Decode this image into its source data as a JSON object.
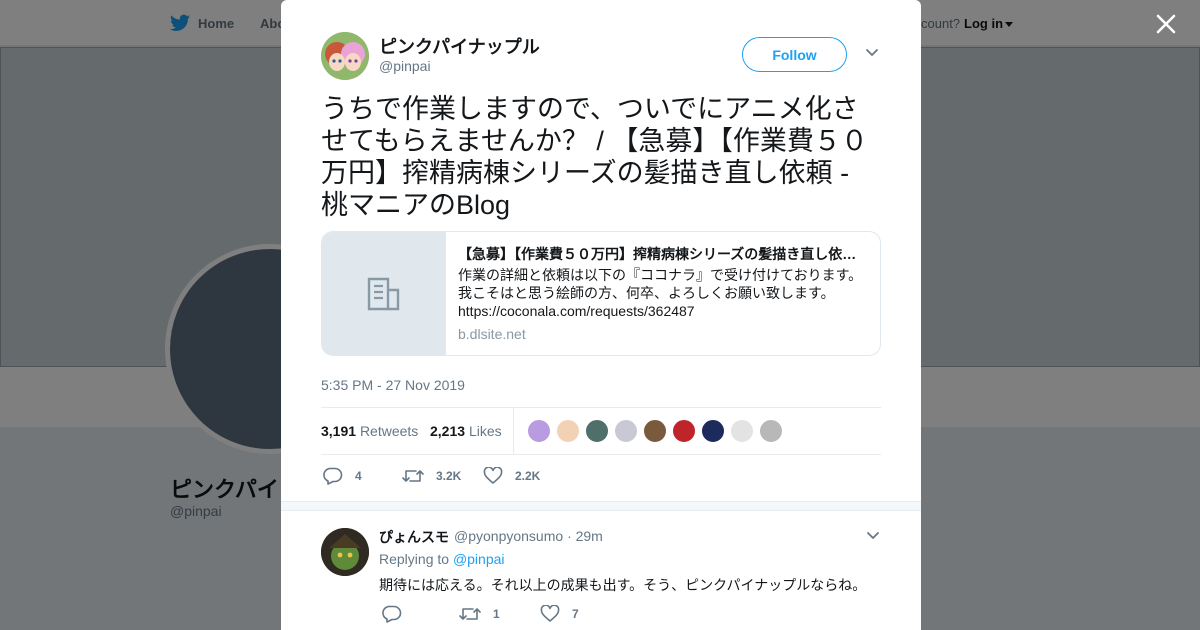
{
  "background": {
    "nav": {
      "home_label": "Home",
      "about_label": "Abo"
    },
    "login": {
      "prompt": "count?",
      "login_label": "Log in"
    },
    "profile_name": "ピンクパイ",
    "profile_handle": "@pinpai"
  },
  "tweet": {
    "author_name": "ピンクパイナップル",
    "author_handle": "@pinpai",
    "follow_label": "Follow",
    "text": "うちで作業しますので、ついでにアニメ化させてもらえませんか？ / 【急募】【作業費５０万円】搾精病棟シリーズの髪描き直し依頼 - 桃マニアのBlog",
    "card": {
      "title": "【急募】【作業費５０万円】搾精病棟シリーズの髪描き直し依…",
      "description_lines": [
        "作業の詳細と依頼は以下の『ココナラ』で受け付けております。",
        "我こそはと思う絵師の方、何卒、よろしくお願い致します。",
        "https://coconala.com/requests/362487"
      ],
      "domain": "b.dlsite.net"
    },
    "timestamp": "5:35 PM - 27 Nov 2019",
    "retweets_count": "3,191",
    "retweets_label": "Retweets",
    "likes_count": "2,213",
    "likes_label": "Likes",
    "liker_colors": [
      "#b99be0",
      "#f3d1b5",
      "#4f6f6a",
      "#c9c9d6",
      "#7a5a3c",
      "#c0242b",
      "#1d2a5c",
      "#e3e3e3",
      "#b8b8b8"
    ],
    "actions": {
      "replies": "4",
      "retweets": "3.2K",
      "likes": "2.2K"
    }
  },
  "reply": {
    "name": "ぴょんスモ",
    "handle": "@pyonpyonsumo",
    "time": "· 29m",
    "replying_prefix": "Replying to",
    "replying_handle": "@pinpai",
    "text": "期待には応える。それ以上の成果も出す。そう、ピンクパイナップルならね。",
    "actions": {
      "replies": "",
      "retweets": "1",
      "likes": "7"
    }
  },
  "colors": {
    "accent": "#1da1f2",
    "muted": "#657786"
  }
}
